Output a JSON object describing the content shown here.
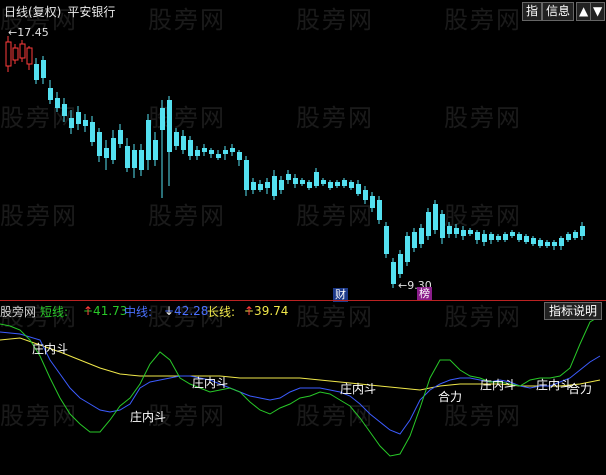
{
  "header": {
    "period": "日线(复权)",
    "stock_name": "平安银行",
    "btn_indicator": "指",
    "btn_info": "信息",
    "icon_up": "arrow-up-icon",
    "icon_down": "arrow-down-icon"
  },
  "price_panel": {
    "high_label": "17.45",
    "low_label": "9.30",
    "event_cai": "财",
    "event_bang": "榜"
  },
  "indicator": {
    "name": "股旁网",
    "short_label": "短线:",
    "short_value": "+41.73",
    "mid_label": "中线:",
    "mid_value": "+42.28",
    "long_label": "长线:",
    "long_value": "+39.74",
    "help_label": "指标说明",
    "signals": [
      "庄内斗",
      "庄内斗",
      "庄内斗",
      "庄内斗",
      "合力",
      "庄内斗",
      "庄内斗",
      "合力"
    ],
    "colors": {
      "short": "#28c828",
      "mid": "#3c5cff",
      "long": "#f0e84a"
    }
  },
  "watermark": "股旁网",
  "colors": {
    "up": "#ff3b3b",
    "down": "#54e0f0",
    "background": "#000000"
  }
}
